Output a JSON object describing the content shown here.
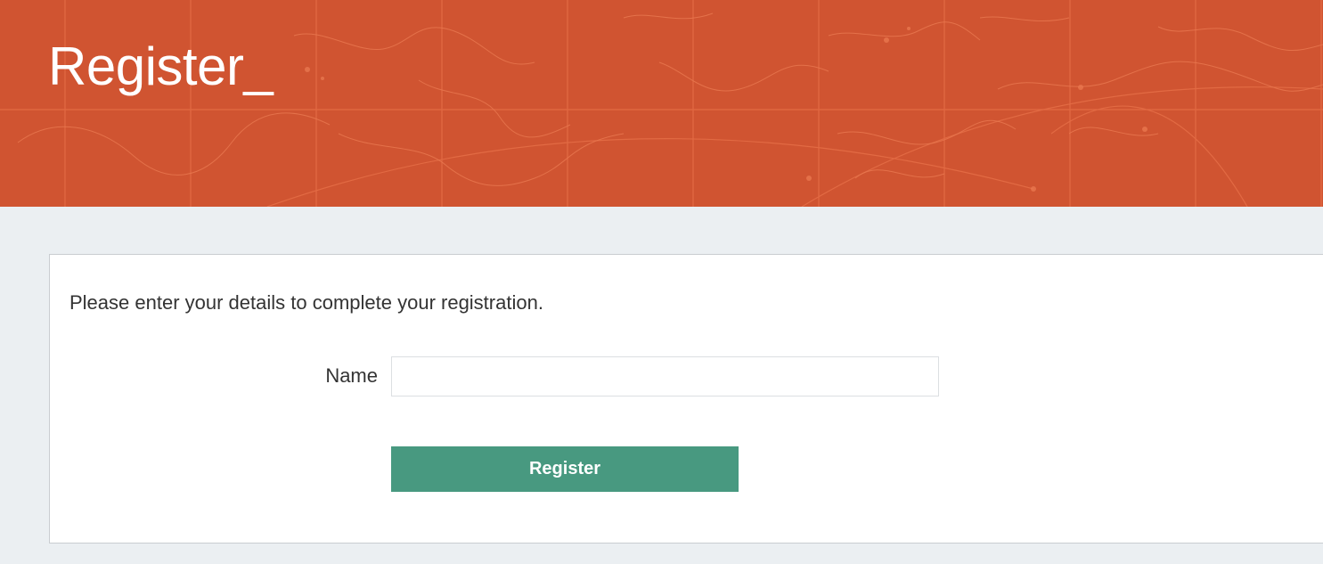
{
  "header": {
    "title": "Register_",
    "background_color": "#d05431",
    "background_decoration": "world-map-outline"
  },
  "form": {
    "intro_text": "Please enter your details to complete your registration.",
    "name_label": "Name",
    "name_value": "",
    "name_placeholder": "",
    "submit_label": "Register",
    "submit_color": "#489980"
  }
}
